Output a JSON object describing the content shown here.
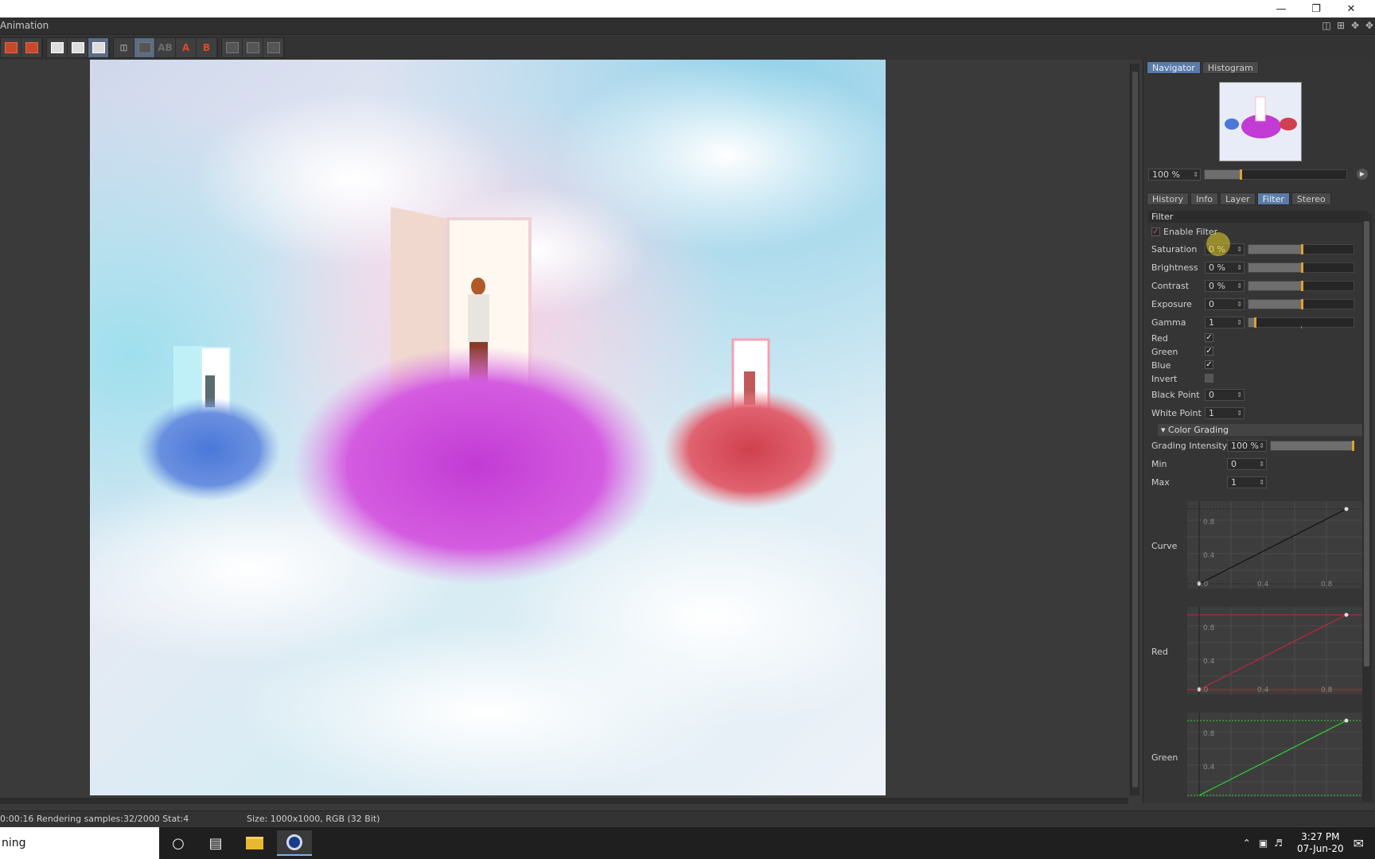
{
  "window": {
    "title": "Animation",
    "controls": [
      "minimize",
      "restore",
      "close"
    ]
  },
  "toolbar": {
    "groups": [
      [
        "render-region",
        "render-active"
      ],
      [
        "view-single",
        "view-split",
        "view-compare"
      ],
      [
        "ab-compare",
        "region-select",
        "ab-toggle",
        "set-a",
        "set-b"
      ],
      [
        "layout-1",
        "layout-2",
        "layout-3"
      ]
    ],
    "label_a": "A",
    "label_b": "B",
    "label_ab": "AB"
  },
  "navigator": {
    "tabs": [
      "Navigator",
      "Histogram"
    ],
    "active_tab": "Navigator",
    "zoom": "100 %"
  },
  "panel_tabs": {
    "tabs": [
      "History",
      "Info",
      "Layer",
      "Filter",
      "Stereo"
    ],
    "active_tab": "Filter"
  },
  "filter": {
    "section_title": "Filter",
    "enable_label": "Enable Filter",
    "enable_checked": true,
    "params": [
      {
        "label": "Saturation",
        "value": "0 %"
      },
      {
        "label": "Brightness",
        "value": "0 %"
      },
      {
        "label": "Contrast",
        "value": "0 %"
      },
      {
        "label": "Exposure",
        "value": "0"
      },
      {
        "label": "Gamma",
        "value": "1"
      }
    ],
    "channels": [
      {
        "label": "Red",
        "checked": true
      },
      {
        "label": "Green",
        "checked": true
      },
      {
        "label": "Blue",
        "checked": true
      },
      {
        "label": "Invert",
        "checked": false
      }
    ],
    "black_point_label": "Black Point",
    "black_point": "0",
    "white_point_label": "White Point",
    "white_point": "1",
    "color_grading": {
      "title": "Color Grading",
      "intensity_label": "Grading Intensity",
      "intensity": "100 %",
      "min_label": "Min",
      "min": "0",
      "max_label": "Max",
      "max": "1"
    },
    "curves": [
      {
        "label": "Curve",
        "color": "#111111"
      },
      {
        "label": "Red",
        "color": "#c0283a"
      },
      {
        "label": "Green",
        "color": "#2fd42f"
      }
    ],
    "curve_ticks_y": [
      "0.8",
      "0.4"
    ],
    "curve_ticks_x": [
      "0.0",
      "0.4",
      "0.8"
    ]
  },
  "status": {
    "render_info": "0:00:16 Rendering samples:32/2000 Stat:4",
    "size_info": "Size: 1000x1000, RGB (32 Bit)"
  },
  "taskbar": {
    "search_text": "ning",
    "apps": [
      "cortana-icon",
      "task-view-icon",
      "file-explorer-icon",
      "cinema4d-icon"
    ],
    "time": "3:27 PM",
    "date": "07-Jun-20"
  }
}
